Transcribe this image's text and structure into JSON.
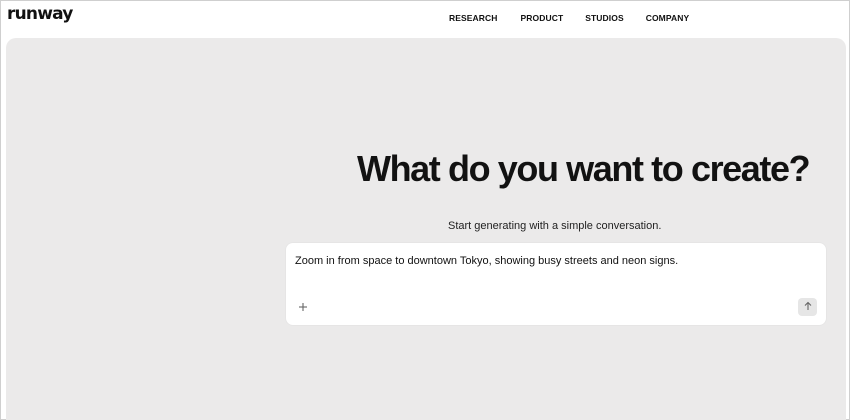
{
  "brand": {
    "logo_text": "runway"
  },
  "nav": {
    "items": [
      {
        "label": "RESEARCH"
      },
      {
        "label": "PRODUCT"
      },
      {
        "label": "STUDIOS"
      },
      {
        "label": "COMPANY"
      }
    ]
  },
  "hero": {
    "title": "What do you want to create?",
    "subtitle": "Start generating with a simple conversation."
  },
  "prompt": {
    "value": "Zoom in from space to downtown Tokyo, showing busy streets and neon signs.",
    "add_icon": "plus-icon",
    "send_icon": "arrow-up-icon"
  },
  "colors": {
    "stage_bg": "#ebeaea",
    "card_bg": "#ffffff",
    "text": "#111111",
    "send_button_bg": "#e6e6e6"
  }
}
